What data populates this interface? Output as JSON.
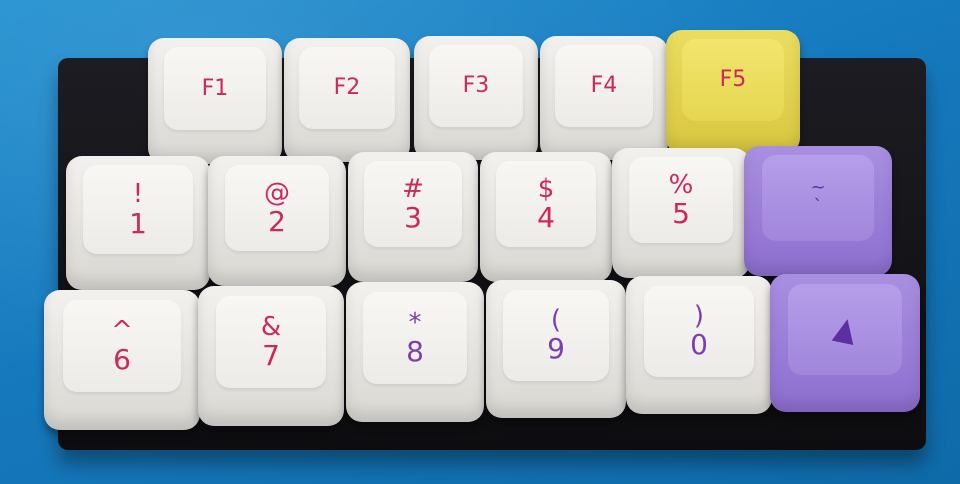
{
  "colors": {
    "legend_pink": "#d0265f",
    "legend_purple": "#7b3fb0",
    "legend_dark_purple": "#5b2fa0",
    "mat_blue": "#1679bd",
    "cap_white": "#f2f1ee",
    "cap_yellow": "#eadd60",
    "cap_purple": "#a98fe0"
  },
  "keys": {
    "f1": "F1",
    "f2": "F2",
    "f3": "F3",
    "f4": "F4",
    "f5": "F5",
    "k1": {
      "top": "!",
      "bottom": "1"
    },
    "k2": {
      "top": "@",
      "bottom": "2"
    },
    "k3": {
      "top": "#",
      "bottom": "3"
    },
    "k4": {
      "top": "$",
      "bottom": "4"
    },
    "k5": {
      "top": "%",
      "bottom": "5"
    },
    "tilde": {
      "top": "~",
      "bottom": "`"
    },
    "k6": {
      "top": "^",
      "bottom": "6"
    },
    "k7": {
      "top": "&",
      "bottom": "7"
    },
    "k8": {
      "top": "*",
      "bottom": "8"
    },
    "k9": {
      "top": "(",
      "bottom": "9"
    },
    "k0": {
      "top": ")",
      "bottom": "0"
    },
    "up_arrow": {
      "icon": "up-arrow-icon"
    }
  }
}
